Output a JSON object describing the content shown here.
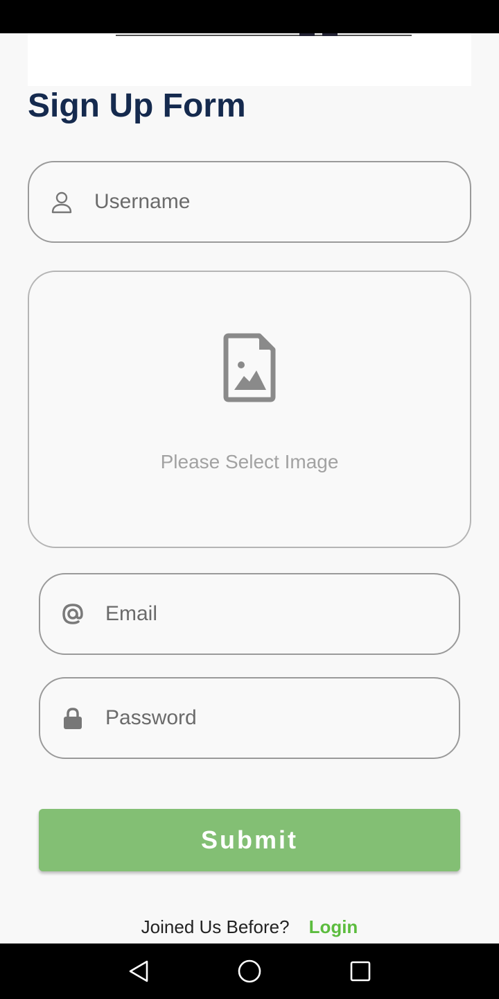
{
  "page": {
    "title": "Sign Up Form"
  },
  "form": {
    "username_placeholder": "Username",
    "image_prompt": "Please Select Image",
    "email_placeholder": "Email",
    "password_placeholder": "Password",
    "submit_label": "Submit"
  },
  "footer": {
    "question": "Joined Us Before?",
    "login_label": "Login"
  },
  "icons": {
    "username": "person-icon",
    "image": "image-file-icon",
    "email": "at-icon",
    "password": "lock-icon",
    "nav_back": "back-triangle-icon",
    "nav_home": "home-circle-icon",
    "nav_recents": "recents-square-icon"
  },
  "colors": {
    "title": "#152a4e",
    "submit_bg": "#83bf74",
    "login_link": "#5cbc3e"
  }
}
